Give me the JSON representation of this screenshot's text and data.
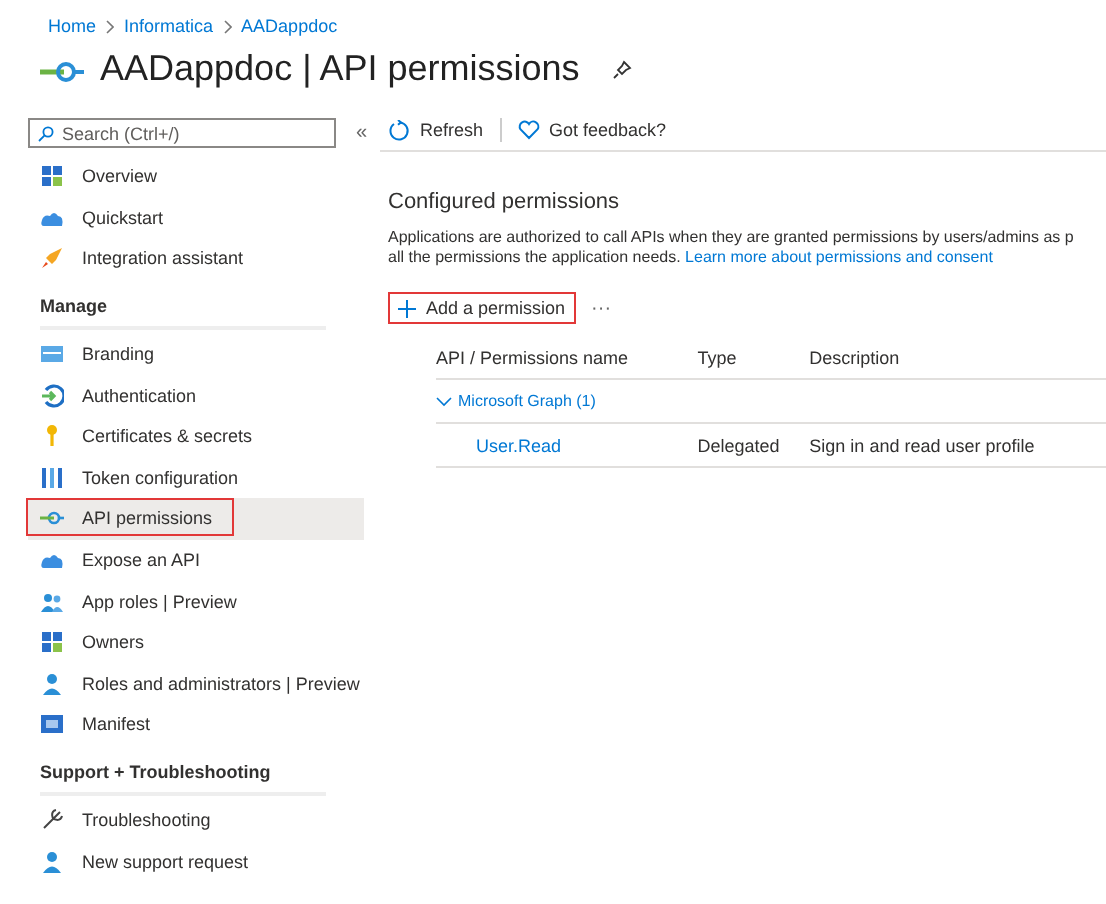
{
  "breadcrumb": [
    "Home",
    "Informatica",
    "AADappdoc"
  ],
  "title": "AADappdoc | API permissions",
  "sidebar": {
    "search": {
      "placeholder": "Search (Ctrl+/)"
    },
    "collapse": "«",
    "groups": [
      {
        "items": [
          {
            "label": "Overview",
            "kind": "grid",
            "selected": false,
            "highlighted": false
          },
          {
            "label": "Quickstart",
            "kind": "cloud",
            "selected": false,
            "highlighted": false
          },
          {
            "label": "Integration assistant",
            "kind": "rocket",
            "selected": false,
            "highlighted": false
          }
        ]
      },
      {
        "heading": "Manage",
        "items": [
          {
            "label": "Branding",
            "kind": "card",
            "selected": false,
            "highlighted": false
          },
          {
            "label": "Authentication",
            "kind": "auth",
            "selected": false,
            "highlighted": false
          },
          {
            "label": "Certificates & secrets",
            "kind": "key",
            "selected": false,
            "highlighted": false
          },
          {
            "label": "Token configuration",
            "kind": "bars",
            "selected": false,
            "highlighted": false
          },
          {
            "label": "API permissions",
            "kind": "api",
            "selected": true,
            "highlighted": true
          },
          {
            "label": "Expose an API",
            "kind": "cloud",
            "selected": false,
            "highlighted": false
          },
          {
            "label": "App roles | Preview",
            "kind": "people",
            "selected": false,
            "highlighted": false
          },
          {
            "label": "Owners",
            "kind": "grid",
            "selected": false,
            "highlighted": false
          },
          {
            "label": "Roles and administrators | Preview",
            "kind": "person",
            "selected": false,
            "highlighted": false
          },
          {
            "label": "Manifest",
            "kind": "doc",
            "selected": false,
            "highlighted": false
          }
        ]
      },
      {
        "heading": "Support + Troubleshooting",
        "items": [
          {
            "label": "Troubleshooting",
            "kind": "wrench",
            "selected": false,
            "highlighted": false
          },
          {
            "label": "New support request",
            "kind": "person",
            "selected": false,
            "highlighted": false
          }
        ]
      }
    ]
  },
  "toolbar": [
    "Refresh",
    "Got feedback?"
  ],
  "section_title": "Configured permissions",
  "description_lines": [
    "Applications are authorized to call APIs when they are granted permissions by users/admins as p",
    "all the permissions the application needs."
  ],
  "description_link": "Learn more about permissions and consent",
  "add_button": {
    "label": "Add a permission",
    "highlighted": true
  },
  "more": "···",
  "table": {
    "columns": [
      "API / Permissions name",
      "Type",
      "Description"
    ],
    "groups": [
      {
        "name": "Microsoft Graph (1)",
        "expanded": true,
        "rows": [
          {
            "name": "User.Read",
            "type": "Delegated",
            "description": "Sign in and read user profile"
          }
        ]
      }
    ]
  }
}
